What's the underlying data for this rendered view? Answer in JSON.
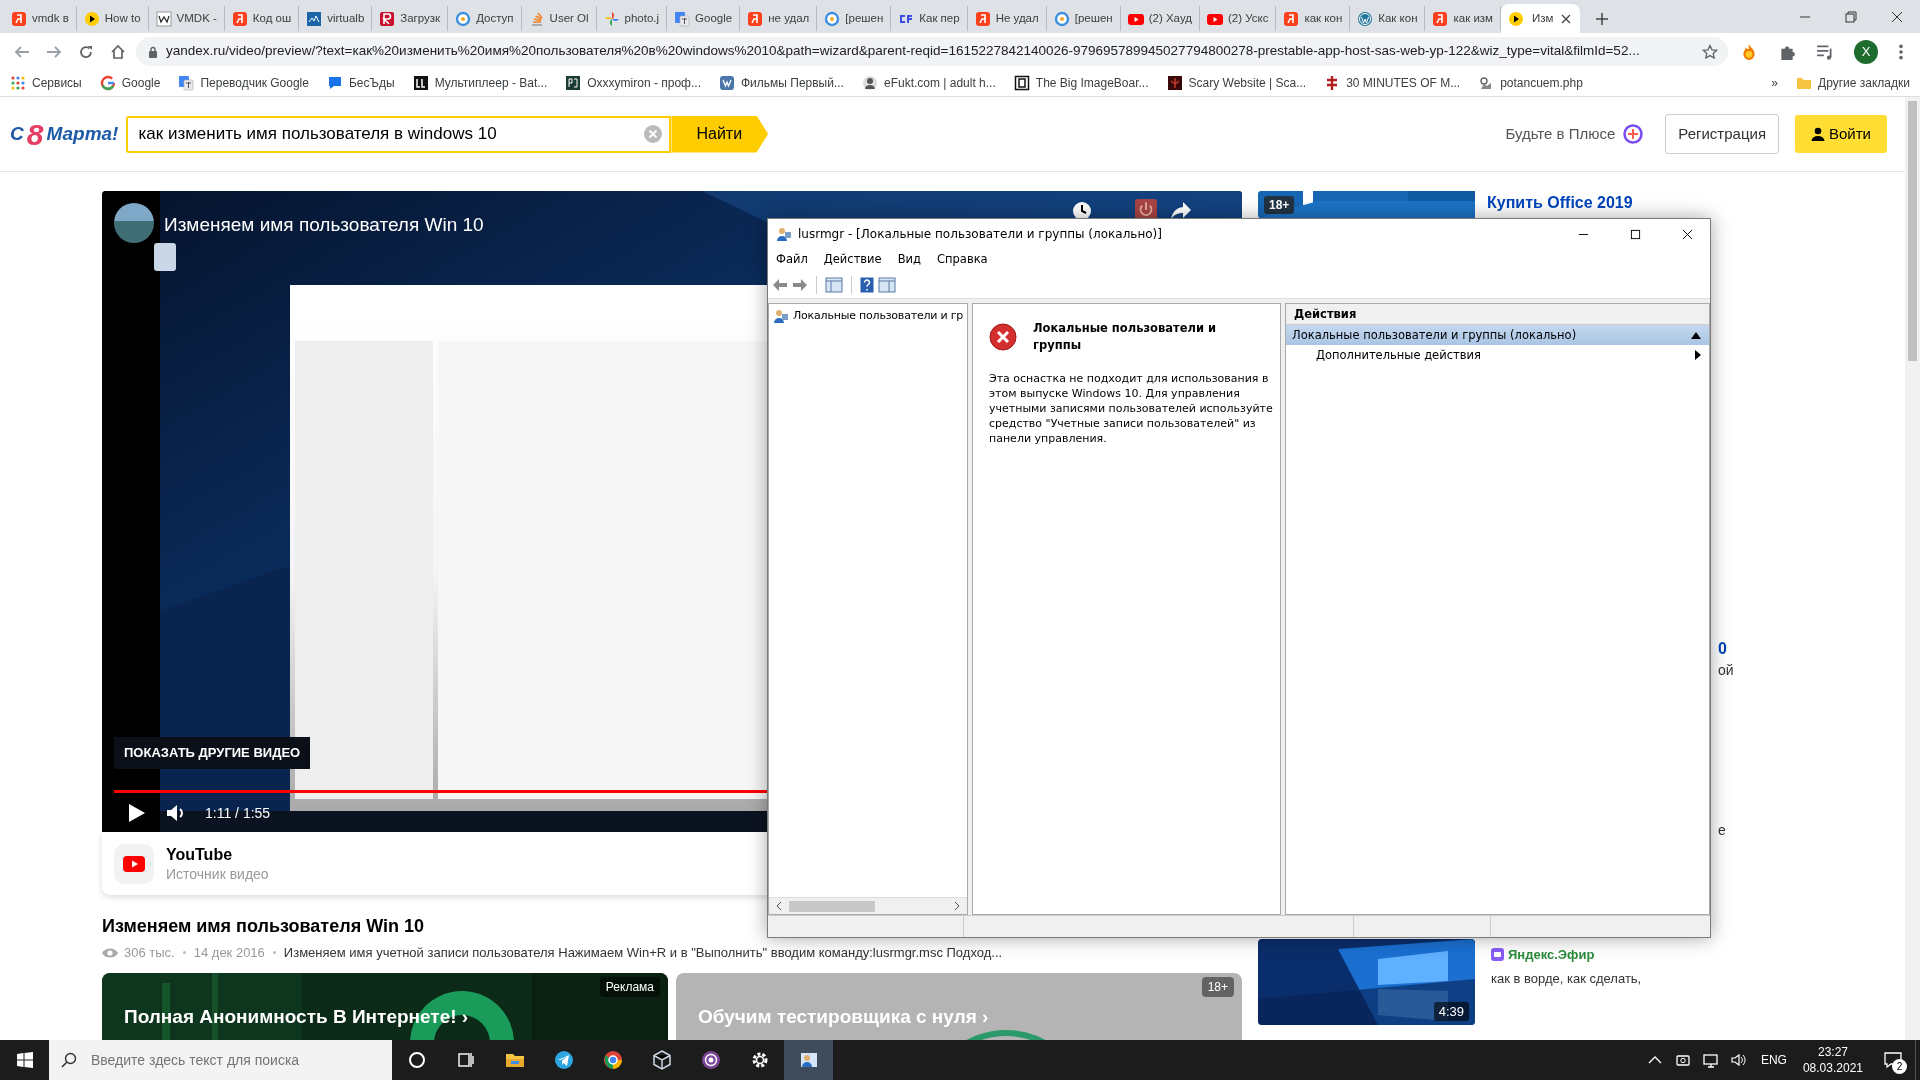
{
  "browser": {
    "tabs": [
      {
        "title": "vmdk в",
        "kind": "ya",
        "selected": false
      },
      {
        "title": "How to",
        "kind": "play",
        "selected": false
      },
      {
        "title": "VMDK -",
        "kind": "w",
        "selected": false
      },
      {
        "title": "Код ош",
        "kind": "ya",
        "selected": false
      },
      {
        "title": "virtualb",
        "kind": "chart",
        "selected": false
      },
      {
        "title": "Загрузк",
        "kind": "r",
        "selected": false
      },
      {
        "title": "Доступ",
        "kind": "ring",
        "selected": false
      },
      {
        "title": "User Ol",
        "kind": "stack",
        "selected": false
      },
      {
        "title": "photo.j",
        "kind": "pinwheel",
        "selected": false
      },
      {
        "title": "Google",
        "kind": "translate",
        "selected": false
      },
      {
        "title": "не удал",
        "kind": "ya",
        "selected": false
      },
      {
        "title": "[решен",
        "kind": "ring",
        "selected": false
      },
      {
        "title": "Как пер",
        "kind": "cf",
        "selected": false
      },
      {
        "title": "Не удал",
        "kind": "ya",
        "selected": false
      },
      {
        "title": "[решен",
        "kind": "ring",
        "selected": false
      },
      {
        "title": "(2) Хауд",
        "kind": "tube",
        "selected": false
      },
      {
        "title": "(2) Ускс",
        "kind": "tube",
        "selected": false
      },
      {
        "title": "как кон",
        "kind": "ya",
        "selected": false
      },
      {
        "title": "Как кон",
        "kind": "wp",
        "selected": false
      },
      {
        "title": "как изм",
        "kind": "ya",
        "selected": false
      },
      {
        "title": "Изм",
        "kind": "play",
        "selected": true
      }
    ],
    "url": "yandex.ru/video/preview/?text=как%20изменить%20имя%20пользователя%20в%20windows%2010&path=wizard&parent-reqid=1615227842140026-979695789945027794800278-prestable-app-host-sas-web-yp-122&wiz_type=vital&filmId=52...",
    "profile": "X",
    "bookmarks": [
      {
        "label": "Сервисы",
        "kind": "apps"
      },
      {
        "label": "Google",
        "kind": "g"
      },
      {
        "label": "Переводчик Google",
        "kind": "translate"
      },
      {
        "label": "БесЪды",
        "kind": "chat"
      },
      {
        "label": "Мультиплеер - Bat...",
        "kind": "bl"
      },
      {
        "label": "Oxxxymiron - проф...",
        "kind": "rg"
      },
      {
        "label": "Фильмы Первый...",
        "kind": "vk"
      },
      {
        "label": "eFukt.com | adult h...",
        "kind": "person"
      },
      {
        "label": "The Big ImageBoar...",
        "kind": "frame"
      },
      {
        "label": "Scary Website | Sca...",
        "kind": "dark"
      },
      {
        "label": "30 MINUTES OF M...",
        "kind": "cross"
      },
      {
        "label": "potancuem.php",
        "kind": "robot"
      }
    ],
    "more": "»",
    "other_bookmarks": "Другие закладки"
  },
  "site": {
    "logo": {
      "prefix": "С",
      "digit": "8",
      "word": "Марта!"
    },
    "search": {
      "value": "как изменить имя пользователя в windows 10",
      "button": "Найти"
    },
    "plus": "Будьте в Плюсе",
    "register": "Регистрация",
    "login": "Войти"
  },
  "player": {
    "title": "Изменяем имя пользователя Win 10",
    "more_videos": "ПОКАЗАТЬ ДРУГИЕ ВИДЕО",
    "time": "1:11 / 1:55",
    "level": 0.617,
    "source": {
      "name": "YouTube",
      "caption": "Источник видео"
    }
  },
  "video": {
    "title": "Изменяем имя пользователя Win 10",
    "views": "306 тыс.",
    "date": "14 дек 2016",
    "description": "Изменяем имя учетной записи пользователя Нажимаем Win+R и в \"Выполнить\" вводим команду:lusrmgr.msc Подход..."
  },
  "cards": [
    {
      "title": "Полная Анонимность В Интернете! ›",
      "badge": "Реклама",
      "kind": "ad"
    },
    {
      "title": "Обучим тестировщика с нуля ›",
      "badge": "18+",
      "kind": "course"
    }
  ],
  "sidebar": {
    "ad_badge": "18+",
    "ad_title": "Купить Office 2019",
    "title_tail": "0",
    "snippet_tail": "ой",
    "line_tail": "е",
    "duration": "4:39",
    "channel": "Яндекс.Эфир",
    "snippet": "как в ворде, как сделать,"
  },
  "window": {
    "title": "lusrmgr - [Локальные пользователи и группы (локально)]",
    "menu": [
      "Файл",
      "Действие",
      "Вид",
      "Справка"
    ],
    "tree": [
      "Локальные пользователи и гр"
    ],
    "message": {
      "title": "Локальные пользователи и группы",
      "text": "Эта оснастка не подходит для использования в этом выпуске Windows 10. Для управления учетными записями пользователей используйте средство \"Учетные записи пользователей\" из панели управления."
    },
    "actions": {
      "header": "Действия",
      "items": [
        {
          "label": "Локальные пользователи и группы (локально)",
          "kind": "group",
          "selected": true
        },
        {
          "label": "Дополнительные действия",
          "kind": "submenu",
          "selected": false
        }
      ]
    }
  },
  "taskbar": {
    "search_placeholder": "Введите здесь текст для поиска",
    "apps": [
      {
        "kind": "cortana",
        "selected": false
      },
      {
        "kind": "taskview",
        "selected": false
      },
      {
        "kind": "explorer",
        "selected": false
      },
      {
        "kind": "telegram",
        "selected": false
      },
      {
        "kind": "chrome",
        "selected": false
      },
      {
        "kind": "box",
        "selected": false
      },
      {
        "kind": "tor",
        "selected": false
      },
      {
        "kind": "gear",
        "selected": false
      },
      {
        "kind": "mmc",
        "selected": true
      }
    ],
    "language": "ENG",
    "time": "23:27",
    "date": "08.03.2021",
    "notifications": "2"
  }
}
